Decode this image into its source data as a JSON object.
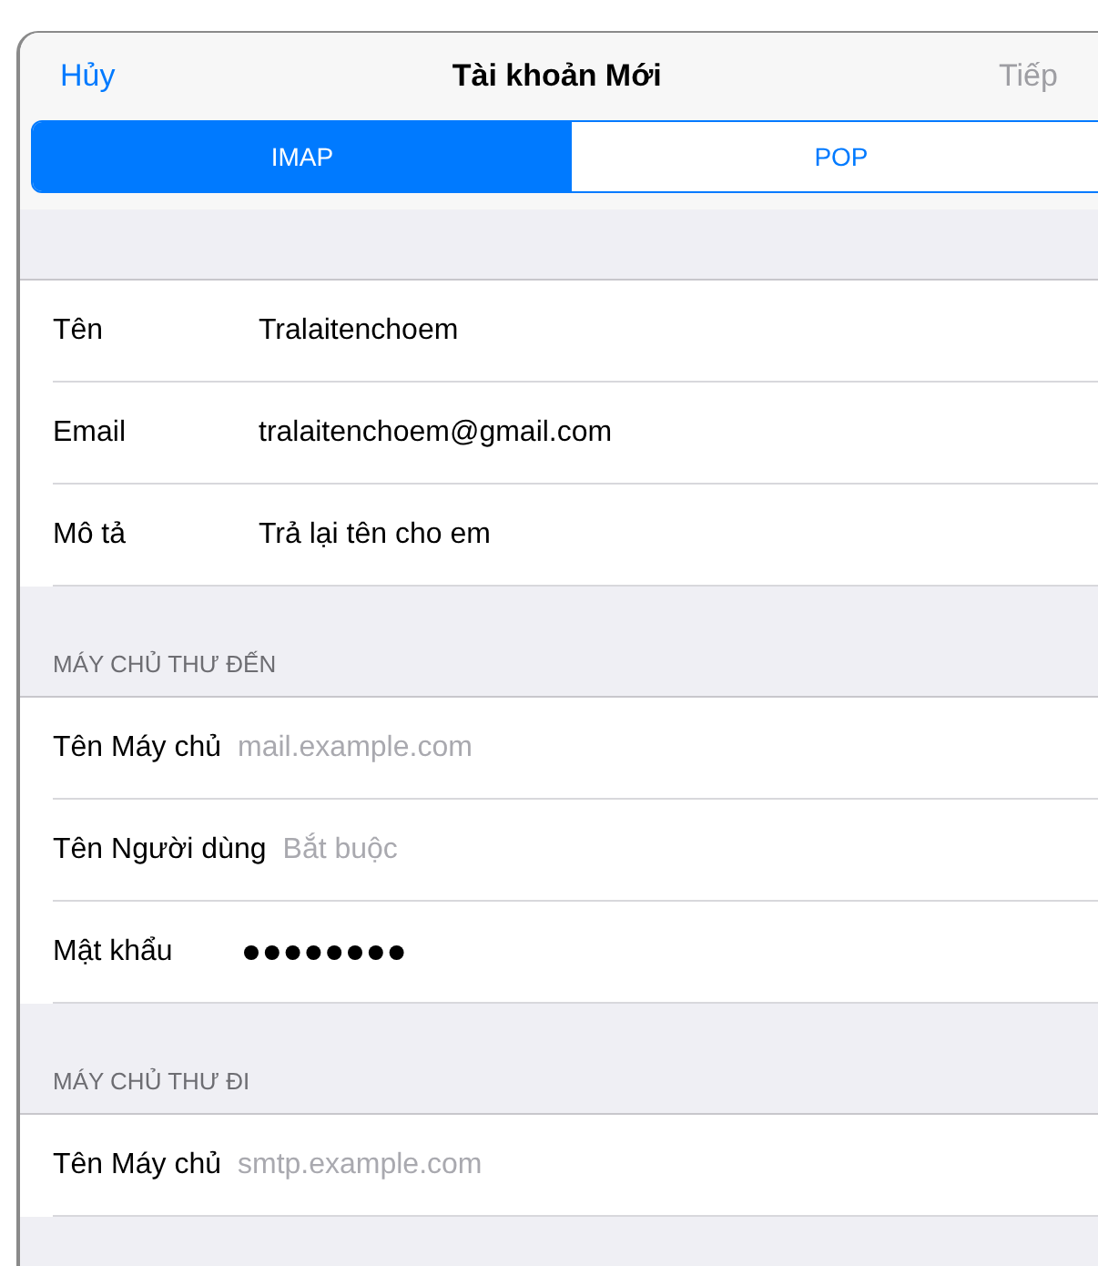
{
  "nav": {
    "cancel": "Hủy",
    "title": "Tài khoản Mới",
    "next": "Tiếp",
    "next_disabled": true
  },
  "segments": [
    {
      "label": "IMAP",
      "selected": true
    },
    {
      "label": "POP",
      "selected": false
    }
  ],
  "sections": [
    {
      "rows": [
        {
          "label": "Tên",
          "value": "Tralaitenchoem"
        },
        {
          "label": "Email",
          "value": "tralaitenchoem@gmail.com"
        },
        {
          "label": "Mô tả",
          "value": "Trả lại tên cho em"
        }
      ]
    },
    {
      "header": "MÁY CHỦ THƯ ĐẾN",
      "rows": [
        {
          "label": "Tên Máy chủ",
          "placeholder": "mail.example.com"
        },
        {
          "label": "Tên Người dùng",
          "placeholder": "Bắt buộc"
        },
        {
          "label": "Mật khẩu",
          "kind": "password",
          "filled": true
        }
      ]
    },
    {
      "header": "MÁY CHỦ THƯ ĐI",
      "rows": [
        {
          "label": "Tên Máy chủ",
          "placeholder": "smtp.example.com"
        }
      ]
    }
  ]
}
